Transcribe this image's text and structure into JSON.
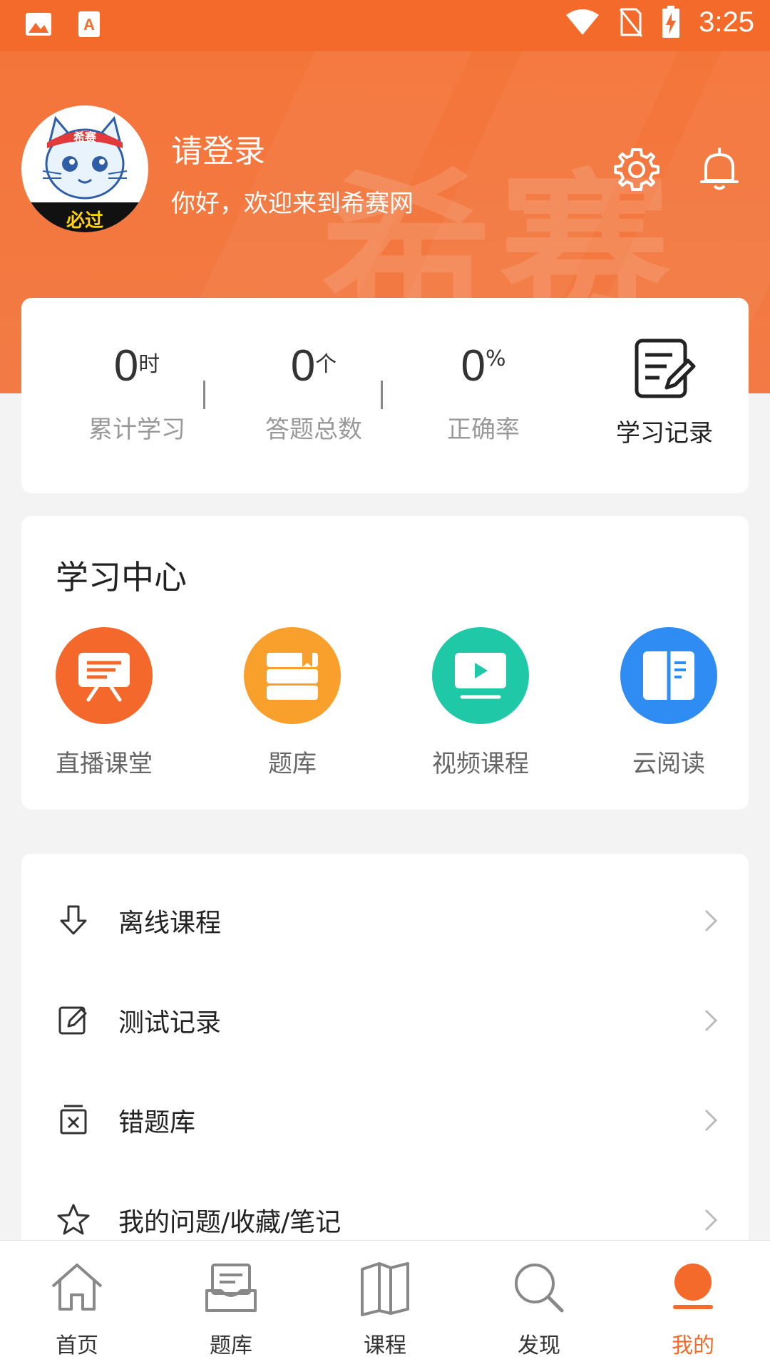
{
  "status_bar": {
    "time": "3:25",
    "icons": [
      "image-icon",
      "font-app-icon",
      "wifi-icon",
      "no-sim-icon",
      "battery-charging-icon"
    ]
  },
  "header": {
    "watermark": "希赛",
    "login_title": "请登录",
    "welcome": "你好，欢迎来到希赛网",
    "avatar": {
      "top_badge": "希赛",
      "bottom_badge": "必过"
    },
    "icons": [
      "settings-icon",
      "bell-icon"
    ]
  },
  "stats": [
    {
      "value": "0",
      "unit": "时",
      "label": "累计学习"
    },
    {
      "value": "0",
      "unit": "个",
      "label": "答题总数"
    },
    {
      "value": "0",
      "unit": "%",
      "label": "正确率"
    }
  ],
  "record": {
    "label": "学习记录",
    "icon": "edit-record-icon"
  },
  "learning_center": {
    "title": "学习中心",
    "items": [
      {
        "label": "直播课堂",
        "icon": "live-class-icon",
        "color": "#f4682c"
      },
      {
        "label": "题库",
        "icon": "question-bank-icon",
        "color": "#f8a02b"
      },
      {
        "label": "视频课程",
        "icon": "video-course-icon",
        "color": "#1fc9a8"
      },
      {
        "label": "云阅读",
        "icon": "cloud-reading-icon",
        "color": "#2f8cf3"
      }
    ]
  },
  "menu": [
    {
      "label": "离线课程",
      "icon": "download-icon"
    },
    {
      "label": "测试记录",
      "icon": "edit-note-icon"
    },
    {
      "label": "错题库",
      "icon": "wrong-question-icon"
    },
    {
      "label": "我的问题/收藏/笔记",
      "icon": "star-icon"
    }
  ],
  "tabs": [
    {
      "label": "首页",
      "icon": "home-icon",
      "active": false
    },
    {
      "label": "题库",
      "icon": "inbox-icon",
      "active": false
    },
    {
      "label": "课程",
      "icon": "book-icon",
      "active": false
    },
    {
      "label": "发现",
      "icon": "search-icon",
      "active": false
    },
    {
      "label": "我的",
      "icon": "profile-icon",
      "active": true
    }
  ],
  "colors": {
    "brand": "#f46a2a",
    "background": "#f3f3f3"
  }
}
